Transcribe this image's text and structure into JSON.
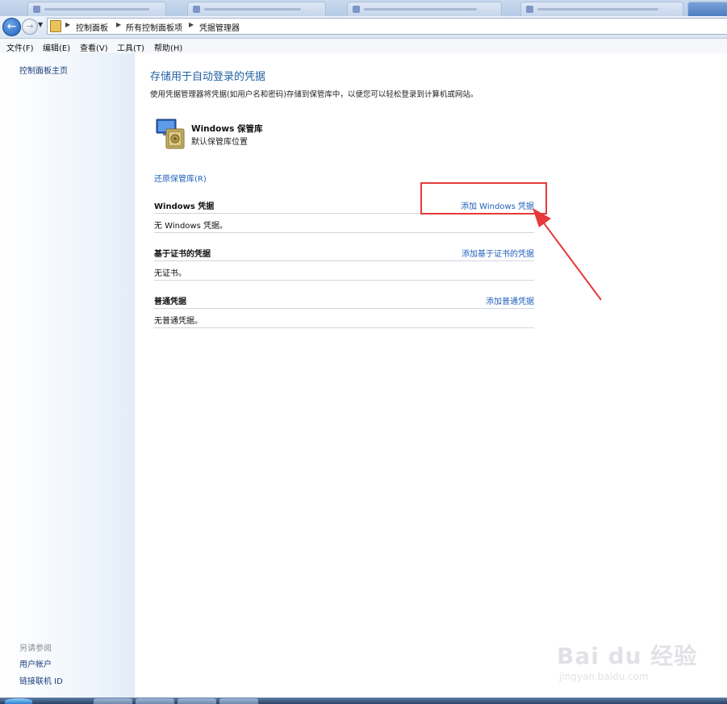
{
  "breadcrumb": [
    "控制面板",
    "所有控制面板项",
    "凭据管理器"
  ],
  "menu": [
    "文件(F)",
    "编辑(E)",
    "查看(V)",
    "工具(T)",
    "帮助(H)"
  ],
  "sidebar": {
    "home": "控制面板主页",
    "see_also": "另请参阅",
    "links": [
      "用户帐户",
      "链接联机 ID"
    ]
  },
  "main": {
    "title": "存储用于自动登录的凭据",
    "description": "使用凭据管理器将凭据(如用户名和密码)存储到保管库中，以便您可以轻松登录到计算机或网站。",
    "vault": {
      "title": "Windows 保管库",
      "subtitle": "默认保管库位置"
    },
    "restore_link": "还原保管库(R)",
    "sections": [
      {
        "title": "Windows 凭据",
        "add_link": "添加 Windows 凭据",
        "empty": "无 Windows 凭据。"
      },
      {
        "title": "基于证书的凭据",
        "add_link": "添加基于证书的凭据",
        "empty": "无证书。"
      },
      {
        "title": "普通凭据",
        "add_link": "添加普通凭据",
        "empty": "无普通凭据。"
      }
    ]
  },
  "watermark": {
    "brand": "Bai du 经验",
    "url": "jingyan.baidu.com"
  },
  "colors": {
    "link": "#1f5fb8",
    "title": "#1f5f9f",
    "annotation": "#e63a3a"
  }
}
